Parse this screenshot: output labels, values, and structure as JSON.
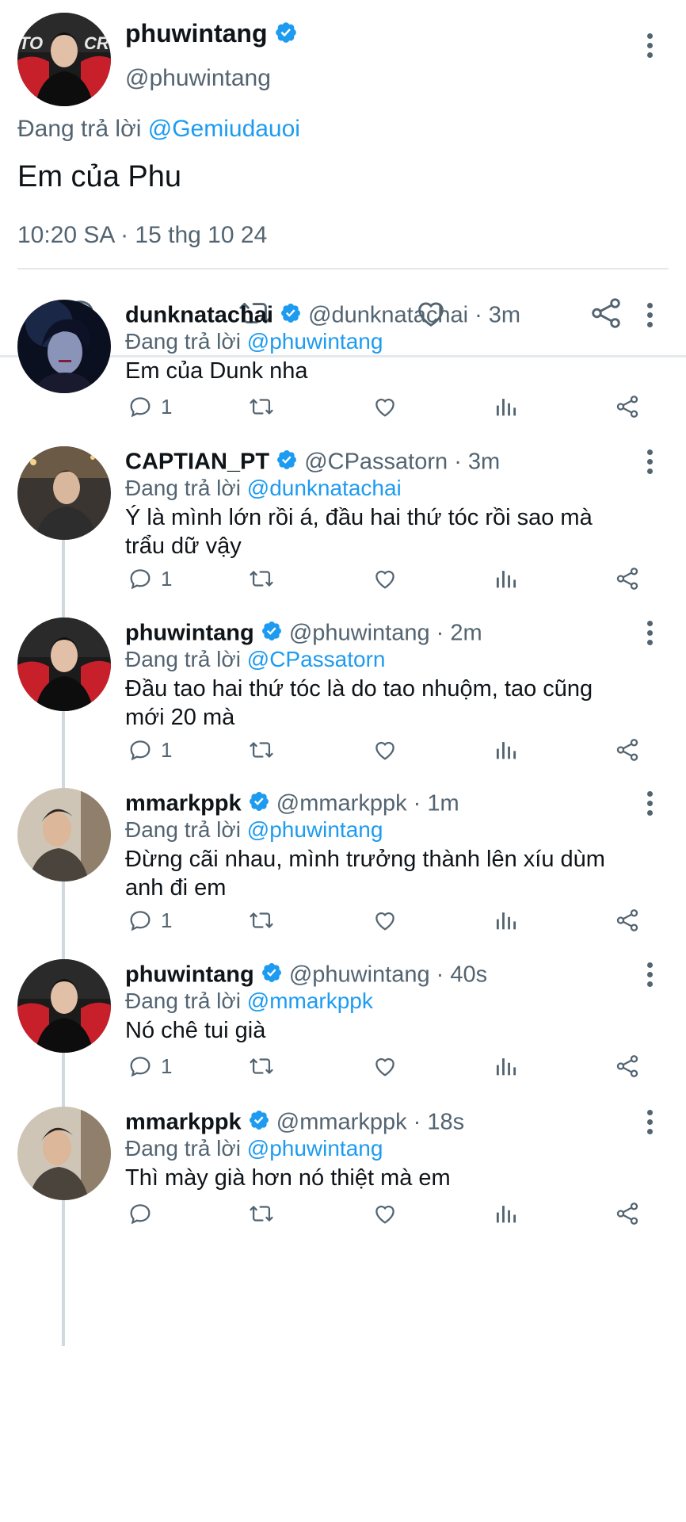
{
  "main_tweet": {
    "name": "phuwintang",
    "handle": "@phuwintang",
    "reply_prefix": "Đang trả lời",
    "reply_to": "@Gemiudauoi",
    "text": "Em của Phu",
    "timestamp": "10:20 SA · 15 thg 10 24"
  },
  "replies": [
    {
      "name": "dunknatachai",
      "handle": "@dunknatachai",
      "time": "· 3m",
      "reply_prefix": "Đang trả lời",
      "reply_to": "@phuwintang",
      "line1": "Em của Dunk nha",
      "line2": "",
      "reply_count": "1"
    },
    {
      "name": "CAPTIAN_PT",
      "handle": "@CPassatorn",
      "time": "· 3m",
      "reply_prefix": "Đang trả lời",
      "reply_to": "@dunknatachai",
      "line1": "Ý là mình lớn rồi á, đầu hai thứ tóc rồi sao mà",
      "line2": "trẩu dữ vậy",
      "reply_count": "1"
    },
    {
      "name": "phuwintang",
      "handle": "@phuwintang",
      "time": "· 2m",
      "reply_prefix": "Đang trả lời",
      "reply_to": "@CPassatorn",
      "line1": "Đầu tao hai thứ tóc là do tao nhuộm, tao cũng",
      "line2": "mới 20 mà",
      "reply_count": "1"
    },
    {
      "name": "mmarkppk",
      "handle": "@mmarkppk",
      "time": "· 1m",
      "reply_prefix": "Đang trả lời",
      "reply_to": "@phuwintang",
      "line1": "Đừng cãi nhau, mình trưởng thành lên xíu dùm",
      "line2": "anh đi em",
      "reply_count": "1"
    },
    {
      "name": "phuwintang",
      "handle": "@phuwintang",
      "time": "· 40s",
      "reply_prefix": "Đang trả lời",
      "reply_to": "@mmarkppk",
      "line1": "Nó chê tui già",
      "line2": "",
      "reply_count": "1"
    },
    {
      "name": "mmarkppk",
      "handle": "@mmarkppk",
      "time": "· 18s",
      "reply_prefix": "Đang trả lời",
      "reply_to": "@phuwintang",
      "line1": "Thì mày già hơn nó thiệt mà em",
      "line2": "",
      "reply_count": ""
    }
  ],
  "avatar_logo_text": "TOCR",
  "colors": {
    "accent": "#1d9bf0",
    "secondary_text": "#536471",
    "thread_line": "#cfd9de"
  },
  "icons": [
    "verified-badge-icon",
    "more-options-icon",
    "reply-icon",
    "retweet-icon",
    "like-icon",
    "share-icon",
    "views-icon"
  ]
}
